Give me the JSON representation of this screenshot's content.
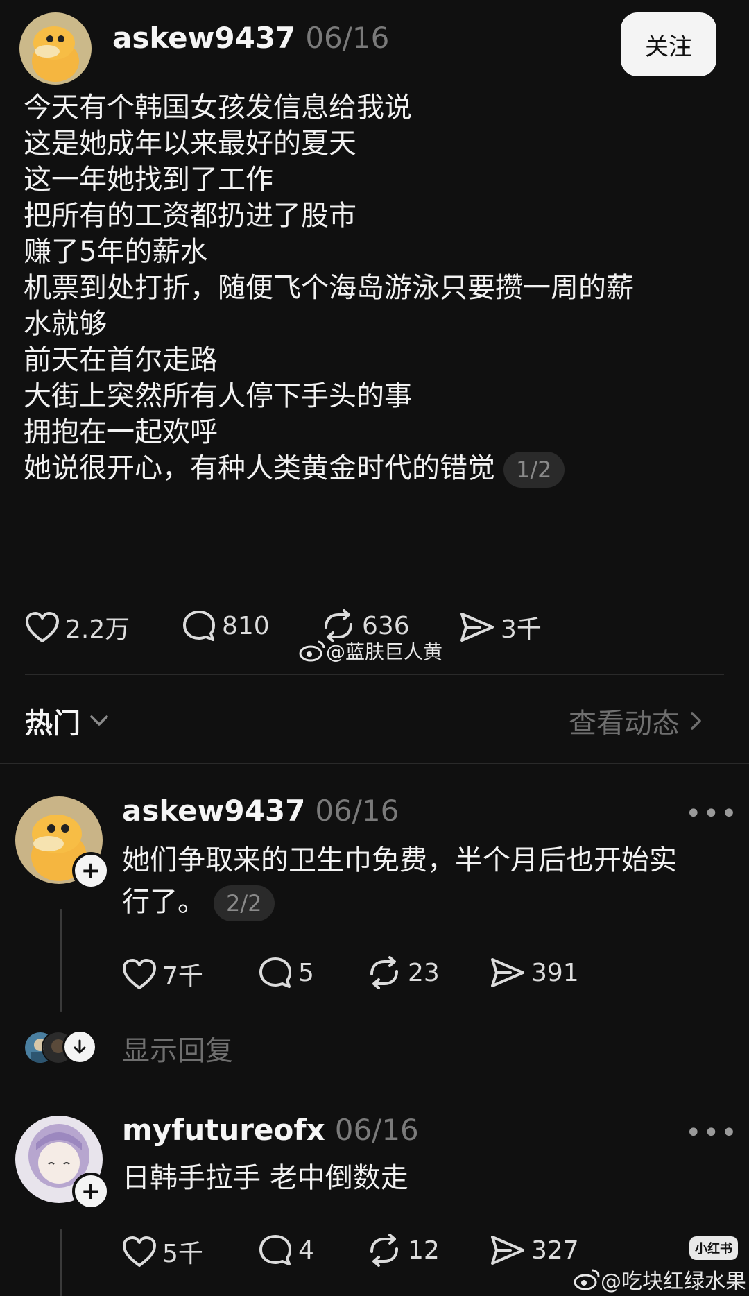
{
  "post": {
    "username": "askew9437",
    "date": "06/16",
    "follow_label": "关注",
    "lines": [
      "今天有个韩国女孩发信息给我说",
      "这是她成年以来最好的夏天",
      "这一年她找到了工作",
      "把所有的工资都扔进了股市",
      "赚了5年的薪水",
      "机票到处打折，随便飞个海岛游泳只要攒一周的薪",
      "水就够",
      "前天在首尔走路",
      "大街上突然所有人停下手头的事",
      "拥抱在一起欢呼",
      "她说很开心，有种人类黄金时代的错觉"
    ],
    "pager": "1/2",
    "likes": "2.2万",
    "comments": "810",
    "reposts": "636",
    "shares": "3千"
  },
  "watermark_mid": "@蓝肤巨人黄",
  "sort": {
    "label": "热门",
    "view_activity": "查看动态"
  },
  "replies": [
    {
      "username": "askew9437",
      "date": "06/16",
      "more": "•••",
      "lines": [
        "她们争取来的卫生巾免费，半个月后也开始实",
        "行了。"
      ],
      "pager": "2/2",
      "likes": "7千",
      "comments": "5",
      "reposts": "23",
      "shares": "391",
      "show_replies": "显示回复"
    },
    {
      "username": "myfutureofx",
      "date": "06/16",
      "more": "•••",
      "lines": [
        "日韩手拉手 老中倒数走"
      ],
      "likes": "5千",
      "comments": "4",
      "reposts": "12",
      "shares": "327"
    }
  ],
  "watermark_bottom": "@吃块红绿水果",
  "watermark_logo": "小红书",
  "icons": {
    "like": "heart-icon",
    "comment": "comment-bubble-icon",
    "repost": "repost-arrows-icon",
    "share": "send-arrow-icon",
    "weibo": "weibo-logo-icon"
  },
  "colors": {
    "background": "#101010",
    "text": "#f2f2f2",
    "muted": "#7a7a7a",
    "button": "#f4f4f4"
  }
}
